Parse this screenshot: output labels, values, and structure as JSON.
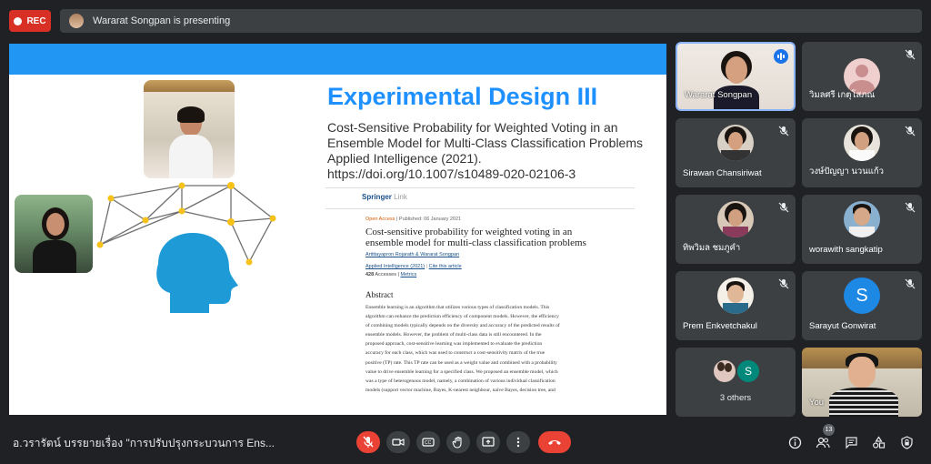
{
  "top_bar": {
    "rec_label": "REC",
    "presenter_text": "Wararat Songpan is presenting"
  },
  "slide": {
    "title": "Experimental Design III",
    "citation_lines": [
      "Cost-Sensitive Probability for Weighted Voting in an",
      "Ensemble Model for Multi-Class Classification Problems",
      "Applied Intelligence (2021).",
      "https://doi.org/10.1007/s10489-020-02106-3"
    ],
    "paper": {
      "publisher": "Springer",
      "publisher_suffix": "Link",
      "open_access": "Open Access",
      "published": "Published: 06 January 2021",
      "title": "Cost-sensitive probability for weighted voting in an ensemble model for multi-class classification problems",
      "authors": "Artittayapron Rojarath & Wararat Songpan",
      "journal": "Applied Intelligence (2021)",
      "cite": "Cite this article",
      "accesses_count": "428",
      "accesses_label": "Accesses",
      "metrics": "Metrics",
      "abstract_heading": "Abstract",
      "abstract_lines": [
        "Ensemble learning is an algorithm that utilizes various types of classification models. This",
        "algorithm can enhance the prediction efficiency of component models. However, the efficiency",
        "of combining models typically depends on the diversity and accuracy of the predicted results of",
        "ensemble models. However, the problem of multi-class data is still encountered. In the",
        "proposed approach, cost-sensitive learning was implemented to evaluate the prediction",
        "accuracy for each class, which was used to construct a cost-sensitivity matrix of the true",
        "positive (TP) rate. This TP rate can be used as a weight value and combined with a probability",
        "value to drive ensemble learning for a specified class. We proposed an ensemble model, which",
        "was a type of heterogenous model, namely, a combination of various individual classification",
        "models (support vector machine, Bayes, K-nearest neighbour, naïve Bayes, decision tree, and"
      ]
    }
  },
  "participants": [
    {
      "name": "Wararat Songpan",
      "state": "speaking"
    },
    {
      "name": "วิมลศรี เกตุโสภณ",
      "state": "muted"
    },
    {
      "name": "Sirawan Chansiriwat",
      "state": "muted"
    },
    {
      "name": "วงษ์ปัญญา นวนแก้ว",
      "state": "muted"
    },
    {
      "name": "ทิพวิมล ชมภูคำ",
      "state": "muted"
    },
    {
      "name": "worawith sangkatip",
      "state": "muted"
    },
    {
      "name": "Prem Enkvetchakul",
      "state": "muted"
    },
    {
      "name": "Sarayut Gonwirat",
      "state": "muted",
      "initial": "S"
    },
    {
      "name": "3 others",
      "initial": "S"
    },
    {
      "name": "You"
    }
  ],
  "bottom_bar": {
    "meeting_title": "อ.วรารัตน์ บรรยายเรื่อง \"การปรับปรุงกระบวนการ Ens...",
    "people_count": "13"
  },
  "colors": {
    "background": "#202124",
    "tile": "#3c4043",
    "accent_blue": "#1a73e8",
    "rec_red": "#d93025",
    "end_call_red": "#ea4335",
    "slide_title_blue": "#1e90ff"
  }
}
